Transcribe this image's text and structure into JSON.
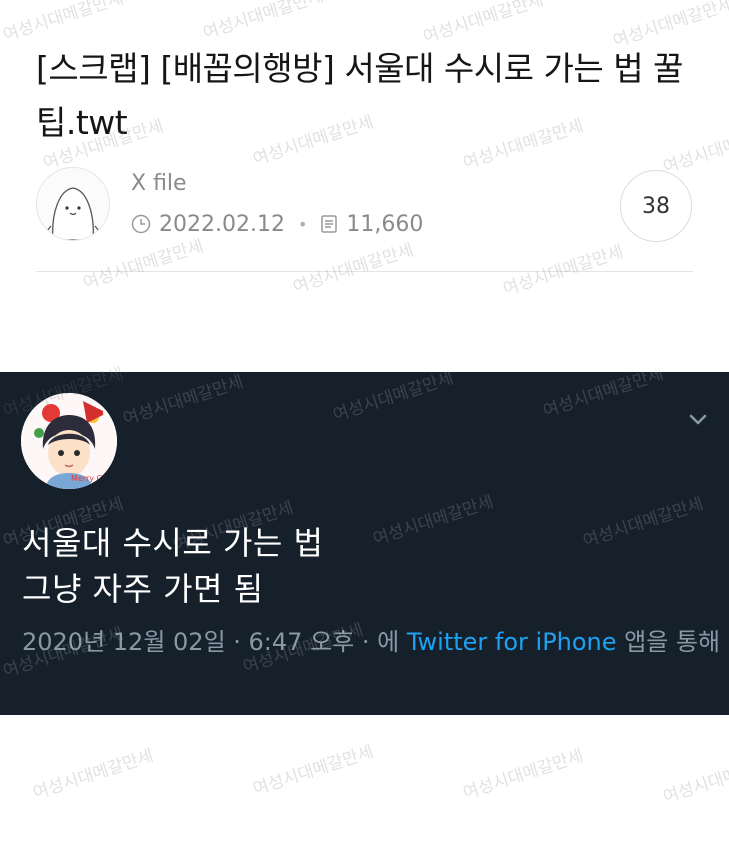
{
  "post": {
    "title": "[스크랩] [배꼽의행방] 서울대 수시로 가는 법 꿀팁.twt",
    "author": "X file",
    "date": "2022.02.12",
    "views": "11,660",
    "comment_count": "38"
  },
  "tweet": {
    "lines": [
      "서울대 수시로 가는 법",
      "그냥 자주 가면 됨"
    ],
    "meta_prefix": "2020년 12월 02일 · 6:47 오후 · 에 ",
    "source_app": "Twitter for iPhone",
    "meta_suffix": " 앱을 통해",
    "avatar_caption": "Merry Christmas"
  },
  "watermark": {
    "text": "여성시대메갈만세"
  },
  "icons": {
    "clock": "clock-icon",
    "views": "document-icon",
    "menu": "chevron-down-icon"
  },
  "colors": {
    "tweet_background": "#15202b",
    "tweet_text": "#ffffff",
    "tweet_meta": "#8899a6",
    "tweet_link": "#1da1f2",
    "meta_gray": "#8a8a8a"
  }
}
